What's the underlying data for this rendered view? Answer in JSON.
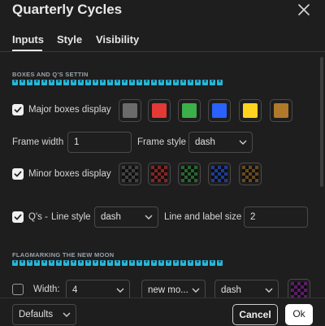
{
  "dialog": {
    "title": "Quarterly Cycles"
  },
  "tabs": [
    {
      "label": "Inputs",
      "active": true
    },
    {
      "label": "Style",
      "active": false
    },
    {
      "label": "Visibility",
      "active": false
    }
  ],
  "sections": {
    "boxes": {
      "title": "BOXES AND Q'S SETTIN",
      "marker_glyph": "▼"
    },
    "flag": {
      "title": "FLAGMARKING THE NEW MOON",
      "marker_glyph": "▼"
    }
  },
  "major": {
    "checked": true,
    "label": "Major boxes display",
    "colors": [
      "#6b6b6b",
      "#e53935",
      "#3cae4a",
      "#2962ff",
      "#ffd21f",
      "#b07a2a"
    ]
  },
  "frame": {
    "width_label": "Frame width",
    "width_value": "1",
    "style_label": "Frame style",
    "style_value": "dash"
  },
  "minor": {
    "checked": true,
    "label": "Minor boxes display",
    "colors": [
      "#6b6b6b",
      "#e53935",
      "#3cae4a",
      "#2962ff",
      "#b07a2a"
    ]
  },
  "qs": {
    "checked": true,
    "label": "Q's -",
    "line_style_label": "Line style",
    "line_style_value": "dash",
    "size_label": "Line and label size",
    "size_value": "2"
  },
  "width_row": {
    "checked": false,
    "label": "Width:",
    "width_value": "4",
    "mode_value": "new mo...",
    "style_value": "dash",
    "color": "#9c27b0"
  },
  "footer": {
    "defaults_label": "Defaults",
    "cancel_label": "Cancel",
    "ok_label": "Ok"
  }
}
